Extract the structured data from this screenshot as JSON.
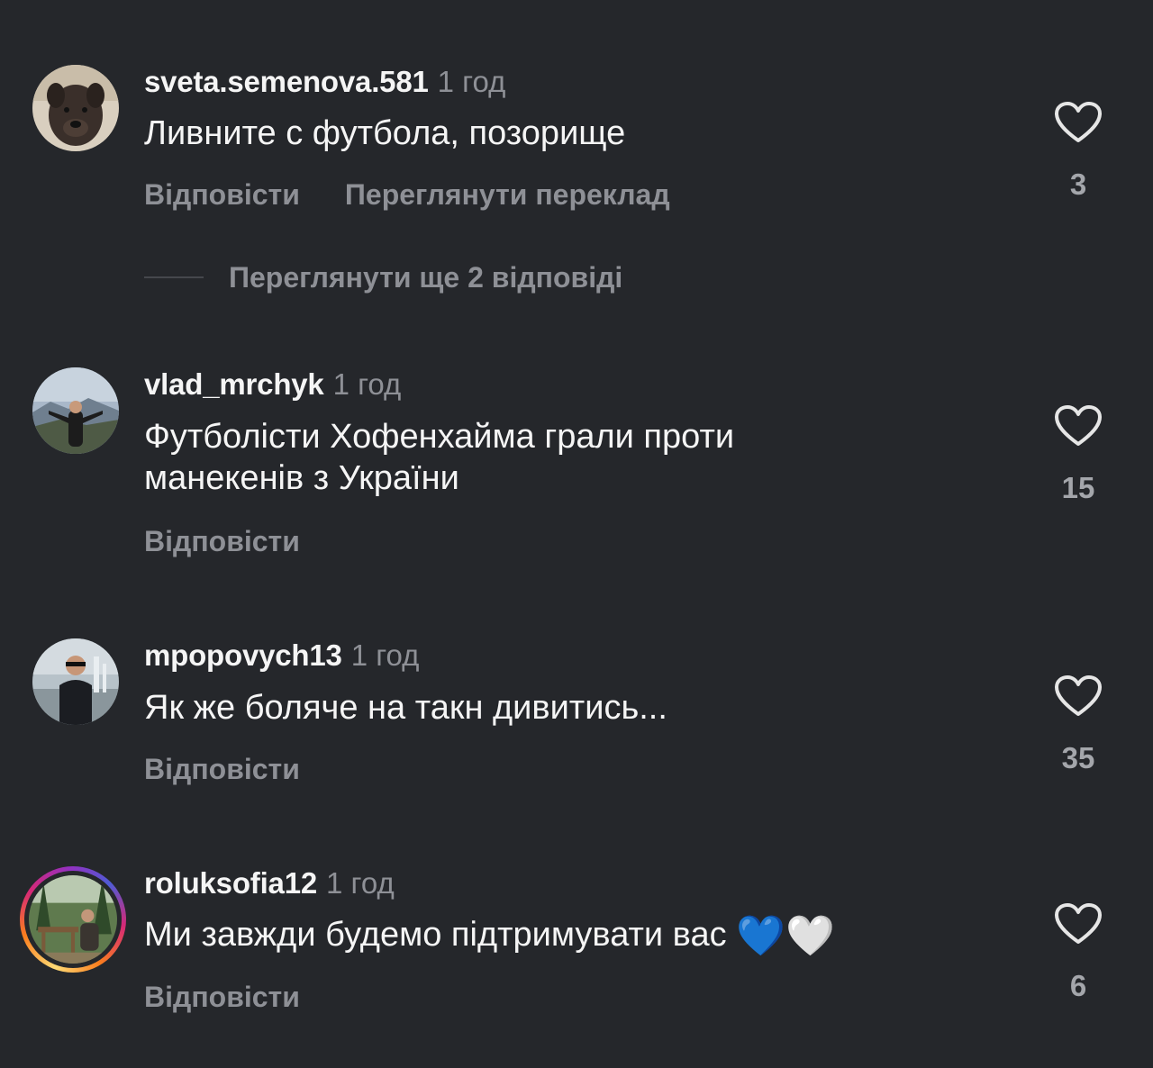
{
  "comments": [
    {
      "username": "sveta.semenova.581",
      "time": "1 год",
      "text": "Ливните с футбола, позорище",
      "reply_label": "Відповісти",
      "translate_label": "Переглянути переклад",
      "likes": "3",
      "avatar_icon": "dog-photo-avatar"
    },
    {
      "username": "vlad_mrchyk",
      "time": "1 год",
      "text_line1": "Футболісти Хофенхайма грали проти",
      "text_line2": "манекенів з України",
      "reply_label": "Відповісти",
      "likes": "15",
      "avatar_icon": "mountain-person-avatar"
    },
    {
      "username": "mpopovych13",
      "time": "1 год",
      "text": "Як же боляче на такн дивитись...",
      "reply_label": "Відповісти",
      "likes": "35",
      "avatar_icon": "man-fountain-avatar"
    },
    {
      "username": "roluksofia12",
      "time": "1 год",
      "text": "Ми завжди будемо підтримувати вас",
      "emojis": [
        "💙",
        "🤍"
      ],
      "reply_label": "Відповісти",
      "likes": "6",
      "avatar_icon": "forest-person-avatar",
      "has_story_ring": true
    }
  ],
  "view_replies": {
    "label": "Переглянути ще 2 відповіді"
  },
  "icons": {
    "like": "heart-outline-icon"
  },
  "colors": {
    "background": "#25272b",
    "primary_text": "#f5f5f5",
    "secondary_text": "#8e9096",
    "story_ring": [
      "#feda75",
      "#fa7e1e",
      "#d62976",
      "#962fbf",
      "#4f5bd5"
    ]
  }
}
